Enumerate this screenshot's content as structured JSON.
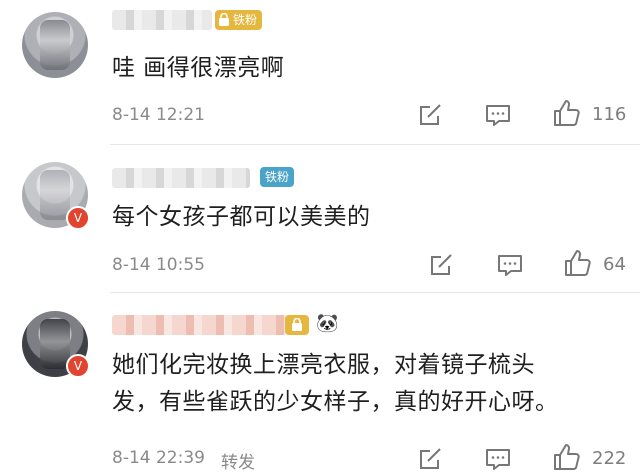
{
  "comments": [
    {
      "badge": "铁粉",
      "text_lines": [
        "哇 画得很漂亮啊"
      ],
      "time": "8-14 12:21",
      "likes": "116",
      "badge_color": "#e6b73e"
    },
    {
      "badge": "铁粉",
      "text_lines": [
        "每个女孩子都可以美美的"
      ],
      "time": "8-14 10:55",
      "likes": "64",
      "badge_color": "#4aa3c8",
      "verified_badge": "V"
    },
    {
      "badge_icon": "lock-icon",
      "extra_emoji": "🐼",
      "text_lines": [
        "她们化完妆换上漂亮衣服，对着镜子梳头",
        "发，有些雀跃的少女样子，真的好开心呀。"
      ],
      "time": "8-14 22:39",
      "repost": "转发",
      "likes": "222",
      "verified_badge": "V"
    }
  ],
  "icons": {
    "share": "share-icon",
    "comment": "comment-icon",
    "like": "thumbs-up-icon"
  }
}
